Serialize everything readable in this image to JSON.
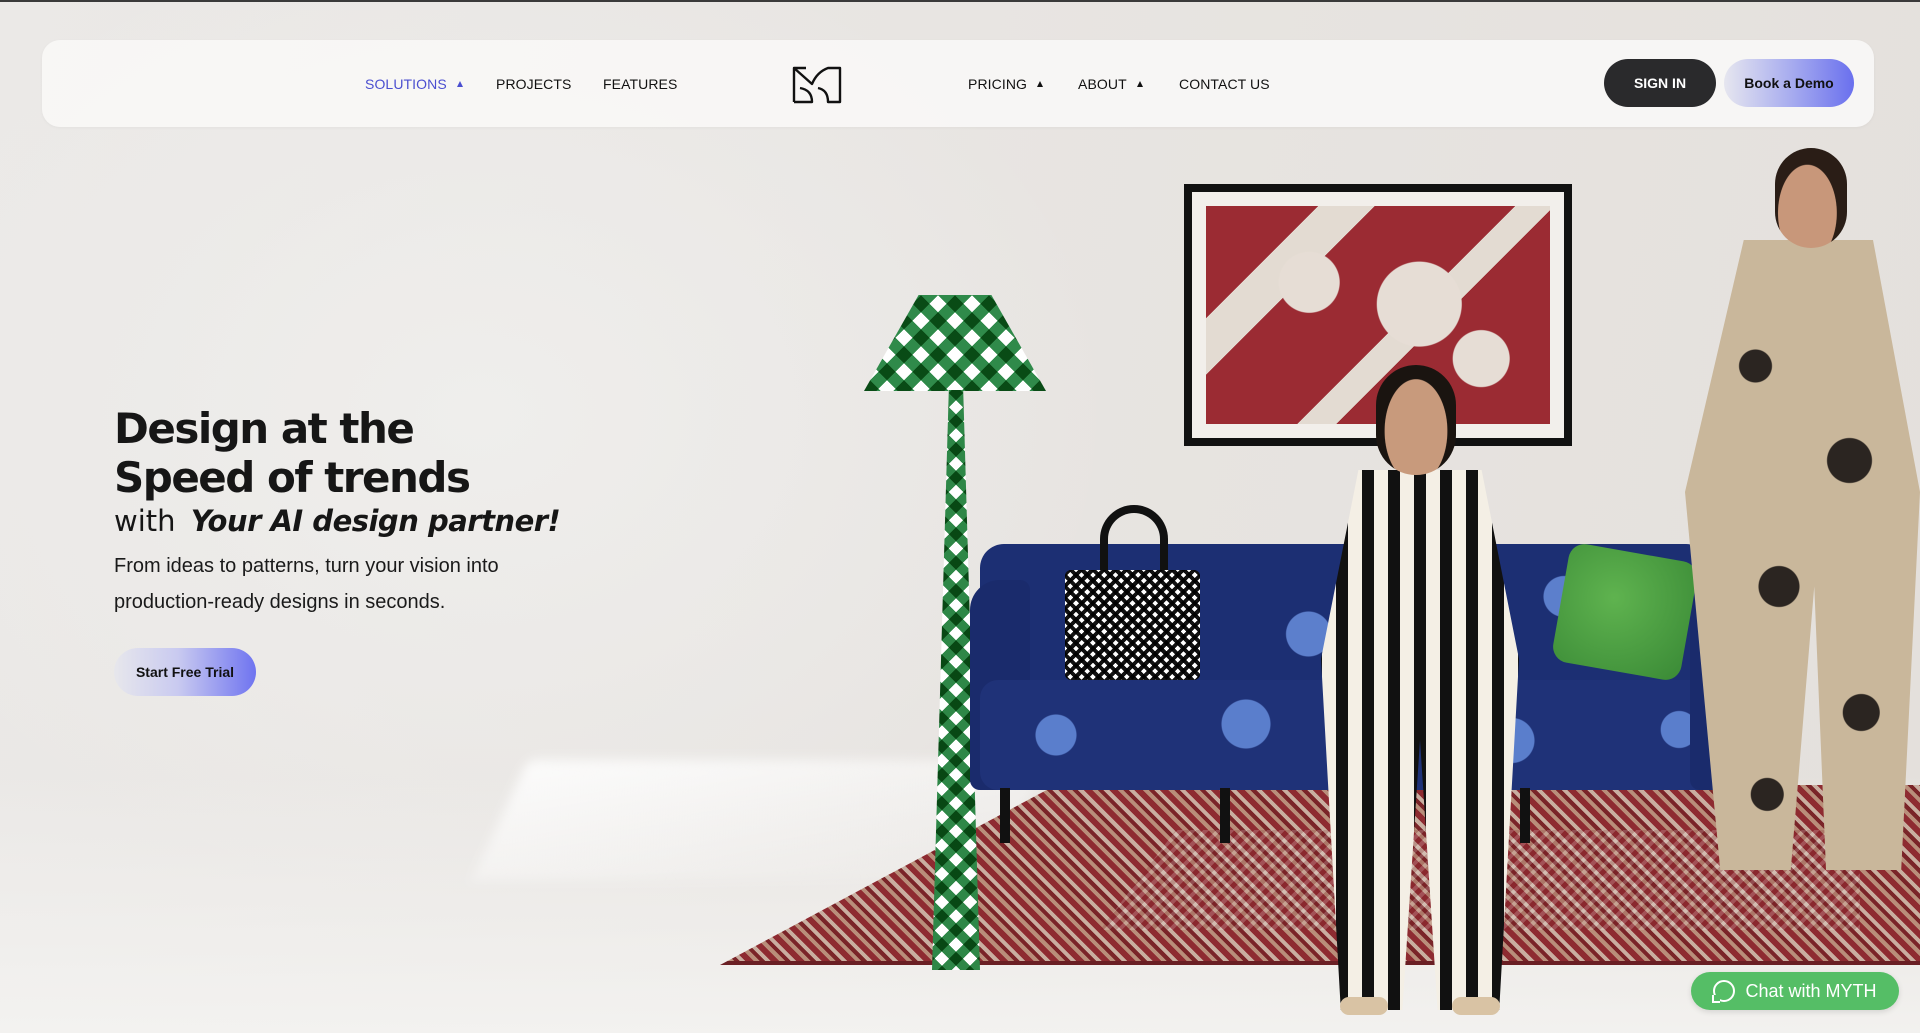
{
  "nav": {
    "items_left": [
      {
        "label": "SOLUTIONS",
        "has_caret": true,
        "active": true
      },
      {
        "label": "PROJECTS",
        "has_caret": false,
        "active": false
      },
      {
        "label": "FEATURES",
        "has_caret": false,
        "active": false
      }
    ],
    "items_right": [
      {
        "label": "PRICING",
        "has_caret": true,
        "active": false
      },
      {
        "label": "ABOUT",
        "has_caret": true,
        "active": false
      },
      {
        "label": "CONTACT US",
        "has_caret": false,
        "active": false
      }
    ],
    "logo_icon": "myth-m-logo-icon",
    "signin_label": "SIGN IN",
    "demo_label": "Book a Demo"
  },
  "hero": {
    "headline_line1": "Design at the",
    "headline_line2": "Speed of trends",
    "subline_prefix": "with",
    "subline_emphasis": "Your AI design partner!",
    "description": "From ideas to patterns, turn your vision into production-ready designs in seconds.",
    "cta_label": "Start Free Trial"
  },
  "chat": {
    "label": "Chat with MYTH",
    "icon": "whatsapp-icon"
  },
  "colors": {
    "accent": "#4b4fd0",
    "signin_bg": "#2a2a2c",
    "chat_bg": "#55be66"
  }
}
